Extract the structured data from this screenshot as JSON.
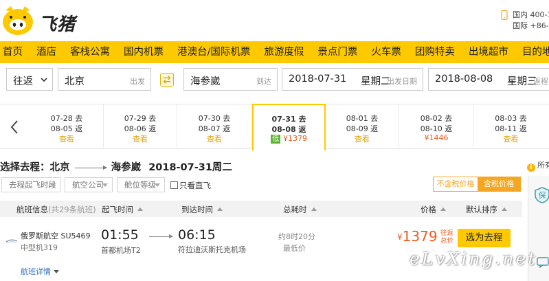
{
  "header": {
    "logo_text": "飞猪",
    "contact_domestic": "国内 400-1",
    "contact_international": "国际 +86-5"
  },
  "nav": {
    "items": [
      "首页",
      "酒店",
      "客栈公寓",
      "国内机票",
      "港澳台/国际机票",
      "旅游度假",
      "景点门票",
      "火车票",
      "团购特卖",
      "出境超市",
      "目的地"
    ]
  },
  "search": {
    "trip_type": "往返",
    "from_city": "北京",
    "from_hint": "出发",
    "to_city": "海参崴",
    "to_hint": "到达",
    "depart_date": "2018-07-31",
    "depart_weekday": "星期二",
    "depart_hint": "出发日期",
    "return_date": "2018-08-08",
    "return_weekday": "星期三",
    "return_hint": "返程"
  },
  "date_strip": [
    {
      "go": "07-28 去",
      "back": "08-05 返",
      "status": "查看",
      "active": false
    },
    {
      "go": "07-29 去",
      "back": "08-06 返",
      "status": "查看",
      "active": false
    },
    {
      "go": "07-30 去",
      "back": "08-07 返",
      "status": "查看",
      "active": false
    },
    {
      "go": "07-31 去",
      "back": "08-08 返",
      "status": "¥1379",
      "badge": "低",
      "active": true
    },
    {
      "go": "08-01 去",
      "back": "08-09 返",
      "status": "查看",
      "active": false
    },
    {
      "go": "08-02 去",
      "back": "08-10 返",
      "status": "¥1446",
      "active": false
    },
    {
      "go": "08-03 去",
      "back": "08-11 返",
      "status": "查看",
      "active": false
    }
  ],
  "section": {
    "prefix": "选择去程：北京",
    "to": "海参崴",
    "date": "2018-07-31周二",
    "side_info": "所有"
  },
  "filters": {
    "time": "去程起飞时段",
    "airline": "航空公司",
    "cabin": "舱位等级",
    "direct_only": "只看直飞",
    "tax_excluded": "不含税价格",
    "tax_included": "含税价格"
  },
  "table_header": {
    "flight_info": "航班信息",
    "flight_count": "(共29条航班)",
    "depart_time": "起飞时间",
    "arrive_time": "到达时间",
    "duration": "总耗时",
    "price": "价格",
    "sort": "默认排序"
  },
  "flight": {
    "airline": "俄罗斯航空 SU5469",
    "aircraft": "中型机319",
    "detail_link": "航班详情",
    "depart_time": "01:55",
    "depart_airport": "首都机场T2",
    "arrive_time": "06:15",
    "arrive_airport": "符拉迪沃斯托克机场",
    "duration": "约8时20分",
    "lowest_label": "最低价",
    "currency": "¥",
    "price": "1379",
    "tax_note": "往返总价",
    "book_label": "选为去程"
  },
  "watermark": "eLvXing.net",
  "colors": {
    "brand_yellow": "#ffc900",
    "price_orange": "#f25a1b",
    "accent_orange": "#f5a623",
    "low_green": "#5fb236",
    "link_blue": "#2a6ebb"
  }
}
